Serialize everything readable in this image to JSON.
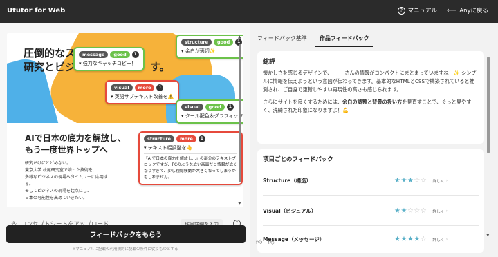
{
  "app": {
    "title": "Ututor for Web",
    "nav": {
      "manual": "マニュアル",
      "back": "Anyに戻る"
    }
  },
  "preview": {
    "hero_line1": "圧倒的なス",
    "hero_line2": "研究とビジ",
    "hero_suffix": "す。",
    "sub_line1": "AIで日本の底力を解放し、",
    "sub_line2": "もう一度世界トップへ",
    "body_lines": [
      "研究だけにとどめない。",
      "東京大学 松尾研究室で培った技術を、",
      "多様なビジネスの現場へタイムリーに応用する。",
      "そしてビジネスの現場を起点にし、",
      "日本の可能性を高めていきたい。"
    ],
    "cards": [
      {
        "tag1": "message",
        "tag2": "good",
        "num": "1",
        "text": "強力なキャッチコピー！"
      },
      {
        "tag1": "structure",
        "tag2": "good",
        "num": "1",
        "text": "余白が適切✨"
      },
      {
        "tag1": "visual",
        "tag2": "more",
        "num": "1",
        "text": "英語サブテキスト改善を⚠️"
      },
      {
        "tag1": "visual",
        "tag2": "good",
        "num": "1",
        "text": "クール配色＆グラフィック😊"
      },
      {
        "tag1": "structure",
        "tag2": "more",
        "num": "1",
        "text": "テキスト幅調整を👆",
        "detail": "「AIで日本の底力を解放し…」の部分のテキストブロックですが、PCのような広い画面だと情報が広くなりすぎて、少し視線移動が大きくなってしまうかもしれません。"
      }
    ]
  },
  "input": {
    "upload_placeholder": "コンセプトシートをアップロード",
    "detail_button": "作品詳細を入力"
  },
  "submit_label": "フィードバックをもらう",
  "note": "※マニュアルに記載の利用規約に記載の条件に従うものとする",
  "tabs": [
    "フィードバック基準",
    "作品フィードバック"
  ],
  "summary": {
    "title": "総評",
    "p1": "懐かしさを感じるデザインで、　　　さんの情報がコンパクトにまとまっていますね！✨ シンプルに情報を伝えようという意図が伝わってきます。基本的なHTMLとCSSで構築されていると推測され、ご自身で更新しやすい再現性の高さも感じられます。",
    "p2_pre": "さらにサイトを良くするためには、",
    "p2_bold": "余白の調整と背景の扱い方",
    "p2_post": "を見直すことで、ぐっと見やすく、洗練された印象になりますよ！💪"
  },
  "feedback": {
    "title": "項目ごとのフィードバック",
    "rows": [
      {
        "label": "Structure（構造）",
        "rating": 3,
        "more": "詳しく"
      },
      {
        "label": "Visual（ビジュアル）",
        "rating": 2,
        "more": "詳しく"
      },
      {
        "label": "Message（メッセージ）",
        "rating": 4,
        "more": "詳しく"
      }
    ]
  }
}
